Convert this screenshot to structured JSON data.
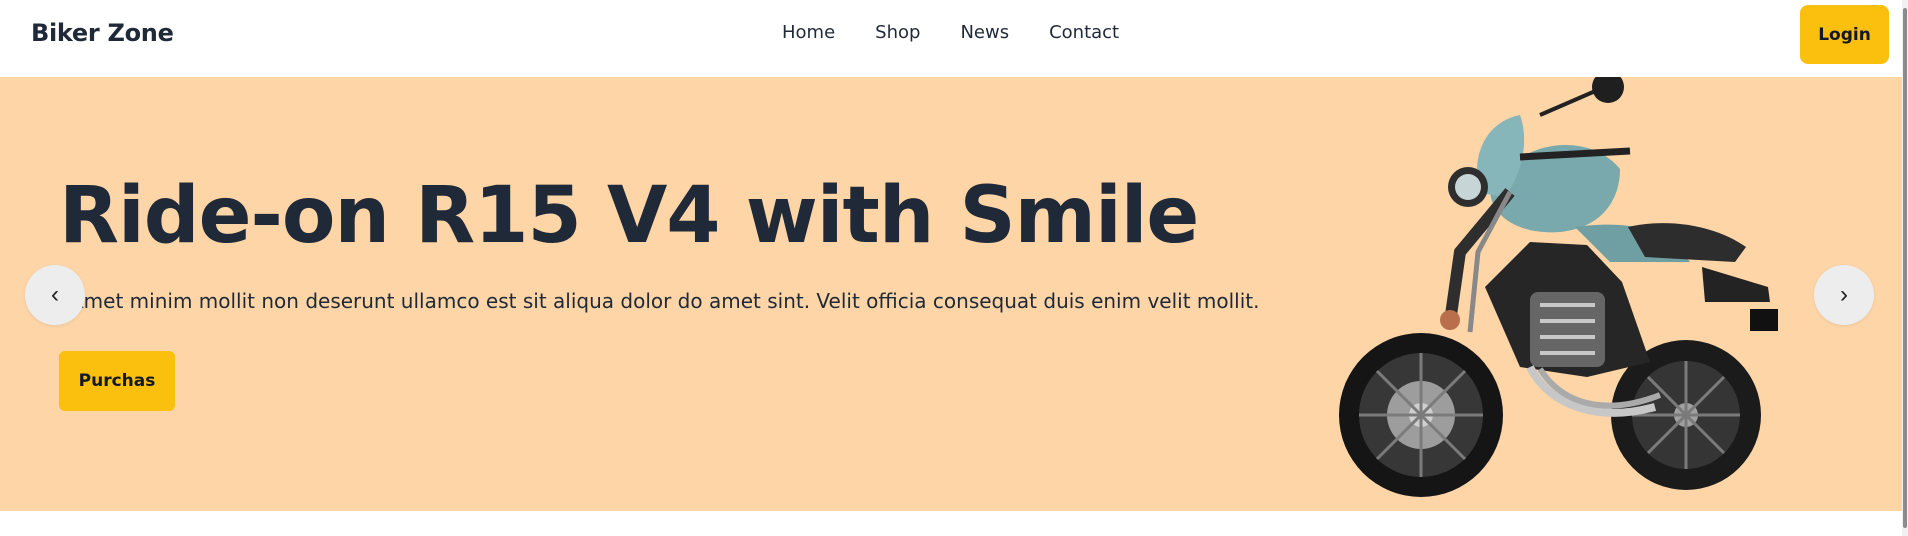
{
  "navbar": {
    "brand": "Biker Zone",
    "links": [
      "Home",
      "Shop",
      "News",
      "Contact"
    ],
    "login_label": "Login"
  },
  "hero": {
    "title": "Ride-on R15 V4 with Smile",
    "description": "Amet minim mollit non deserunt ullamco est sit aliqua dolor do amet sint. Velit officia consequat duis enim velit mollit.",
    "button_label": "Purchas",
    "prev_icon": "‹",
    "next_icon": "›",
    "image": "motorcycle-image",
    "background_color": "#fdd5a7",
    "accent_color": "#fbbf0d"
  }
}
